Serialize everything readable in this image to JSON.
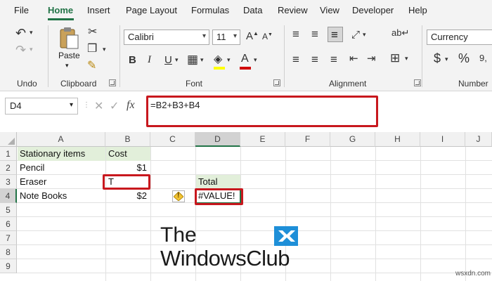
{
  "menu": {
    "tabs": [
      "File",
      "Home",
      "Insert",
      "Page Layout",
      "Formulas",
      "Data",
      "Review",
      "View",
      "Developer",
      "Help"
    ],
    "active": "Home"
  },
  "ribbon": {
    "clipboard": {
      "paste_label": "Paste",
      "group_label": "Clipboard"
    },
    "undo": {
      "group_label": "Undo"
    },
    "font": {
      "name": "Calibri",
      "size": "11",
      "group_label": "Font",
      "bold": "B",
      "italic": "I",
      "underline": "U",
      "font_color_glyph": "A",
      "grow": "A",
      "shrink": "A"
    },
    "alignment": {
      "group_label": "Alignment"
    },
    "number": {
      "format": "Currency",
      "dollar": "$",
      "percent": "%",
      "group_label": "Number"
    }
  },
  "formula_bar": {
    "name_box": "D4",
    "fx": "fx",
    "formula": "=B2+B3+B4"
  },
  "grid": {
    "columns": [
      "A",
      "B",
      "C",
      "D",
      "E",
      "F",
      "G",
      "H",
      "I",
      "J"
    ],
    "rows": [
      "1",
      "2",
      "3",
      "4",
      "5",
      "6",
      "7",
      "8",
      "9"
    ],
    "active_cell": "D4",
    "cells": {
      "A1": "Stationary  items",
      "B1": "Cost",
      "A2": "Pencil",
      "B2": "$1",
      "A3": "Eraser",
      "B3": "T",
      "D3": "Total",
      "A4": "Note Books",
      "B4": "$2",
      "D4": "#VALUE!"
    },
    "error_glyph": "!"
  },
  "watermark": {
    "line1": "The",
    "line2": "WindowsClub"
  },
  "corner_mark": "wsxdn.com",
  "colors": {
    "accent": "#217346",
    "highlight": "#c8181e",
    "cell_fill": "#e2efda"
  }
}
